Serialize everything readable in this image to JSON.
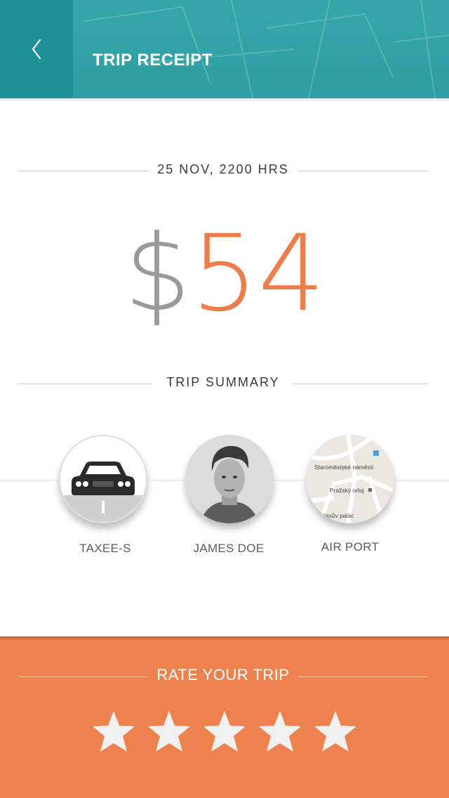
{
  "header": {
    "title": "TRIP RECEIPT",
    "back_icon": "chevron-left-icon",
    "color": "#2e9ea3"
  },
  "receipt": {
    "datetime": "25 NOV, 2200 HRS",
    "currency_symbol": "$",
    "amount": "54",
    "accent": "#ee7d4c"
  },
  "summary": {
    "heading": "TRIP SUMMARY",
    "items": [
      {
        "label": "TAXEE-S",
        "icon": "car-icon"
      },
      {
        "label": "JAMES DOE",
        "icon": "avatar"
      },
      {
        "label": "AIR PORT",
        "icon": "map-thumbnail"
      }
    ],
    "map_labels": [
      "Staroměstské náměstí",
      "Pražský orloj",
      "lasův palác"
    ]
  },
  "rating": {
    "heading": "RATE YOUR TRIP",
    "max_stars": 5,
    "selected": 0,
    "panel_color": "#ee824f"
  }
}
